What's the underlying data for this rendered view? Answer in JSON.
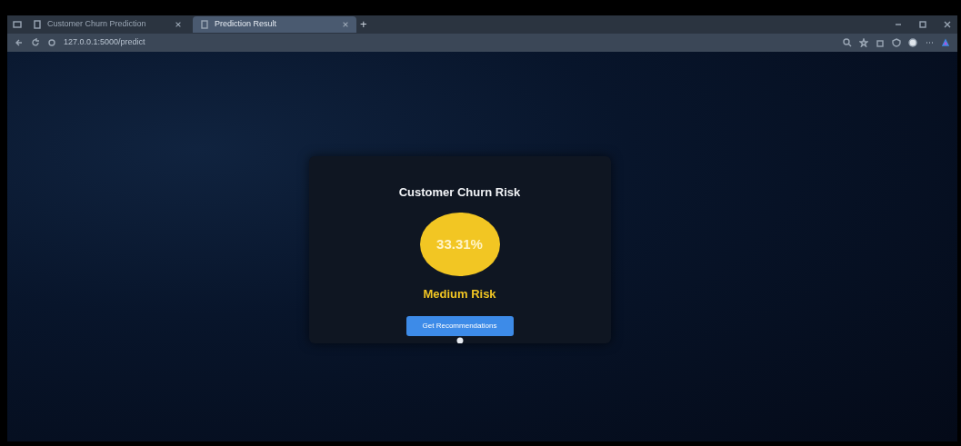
{
  "browser": {
    "tabs": [
      {
        "title": "Customer Churn Prediction",
        "selected": false
      },
      {
        "title": "Prediction Result",
        "selected": true
      }
    ],
    "new_tab": "+",
    "address": "127.0.0.1:5000/predict"
  },
  "result": {
    "title": "Customer Churn Risk",
    "percentage": "33.31%",
    "kind": "medium",
    "risk_label": "Medium Risk",
    "button": "Get Recommendations"
  }
}
